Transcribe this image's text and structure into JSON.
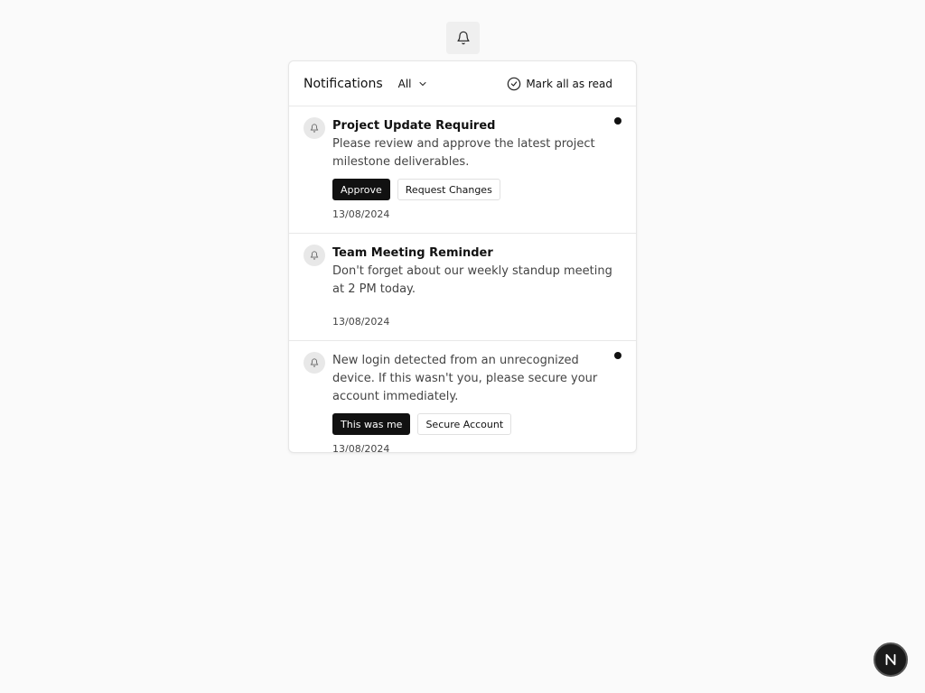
{
  "header": {
    "title": "Notifications",
    "filter_label": "All",
    "mark_all_label": "Mark all as read"
  },
  "notifications": [
    {
      "title": "Project Update Required",
      "body": "Please review and approve the latest project milestone deliverables.",
      "unread": true,
      "actions": [
        {
          "label": "Approve",
          "kind": "primary"
        },
        {
          "label": "Request Changes",
          "kind": "secondary"
        }
      ],
      "date": "13/08/2024"
    },
    {
      "title": "Team Meeting Reminder",
      "body": "Don't forget about our weekly standup meeting at 2 PM today.",
      "unread": false,
      "actions": [],
      "date": "13/08/2024"
    },
    {
      "title": "",
      "body": "New login detected from an unrecognized device. If this wasn't you, please secure your account immediately.",
      "unread": true,
      "actions": [
        {
          "label": "This was me",
          "kind": "primary"
        },
        {
          "label": "Secure Account",
          "kind": "secondary"
        }
      ],
      "date": "13/08/2024"
    }
  ],
  "fab": {
    "letter": "N"
  },
  "colors": {
    "primary": "#111111",
    "background": "#fafafa",
    "border": "#e6e6e6"
  }
}
